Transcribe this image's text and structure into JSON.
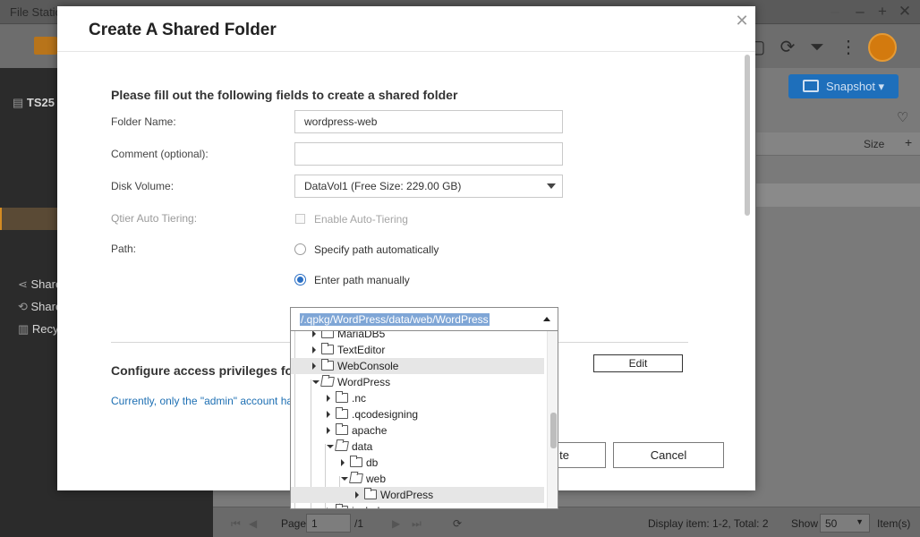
{
  "app": {
    "title": "File Station"
  },
  "toolbar": {
    "icons": [
      "calendar-icon",
      "refresh-icon",
      "filter-icon",
      "more-icon",
      "user-icon"
    ],
    "snapshot_label": "Snapshot"
  },
  "sidebar": {
    "items": [
      {
        "label": "TS25"
      },
      {
        "label": "Share"
      },
      {
        "label": "Share"
      },
      {
        "label": "Recy"
      }
    ]
  },
  "list": {
    "size_header": "Size",
    "add_column": "+"
  },
  "statusbar": {
    "page_label": "Page",
    "page_value": "1",
    "page_total": "/1",
    "display_info": "Display item: 1-2, Total: 2",
    "show_label": "Show",
    "show_value": "50",
    "items_label": "Item(s)"
  },
  "dialog": {
    "title": "Create A Shared Folder",
    "heading": "Please fill out the following fields to create a shared folder",
    "fields": {
      "folder_name_label": "Folder Name:",
      "folder_name_value": "wordpress-web",
      "comment_label": "Comment (optional):",
      "comment_value": "",
      "disk_volume_label": "Disk Volume:",
      "disk_volume_value": "DataVol1 (Free Size: 229.00 GB)",
      "qtier_label": "Qtier Auto Tiering:",
      "qtier_option": "Enable Auto-Tiering",
      "path_label": "Path:",
      "path_auto": "Specify path automatically",
      "path_manual": "Enter path manually"
    },
    "access_heading": "Configure access privileges for u",
    "access_info": "Currently, only the \"admin\" account ha",
    "edit_button": "Edit",
    "create_button": "te",
    "cancel_button": "Cancel"
  },
  "path_picker": {
    "value": "/.qpkg/WordPress/data/web/WordPress",
    "tree": [
      {
        "name": "MariaDB5",
        "level": 0,
        "expanded": false
      },
      {
        "name": "TextEditor",
        "level": 0,
        "expanded": false
      },
      {
        "name": "WebConsole",
        "level": 0,
        "expanded": false
      },
      {
        "name": "WordPress",
        "level": 0,
        "expanded": true
      },
      {
        "name": ".nc",
        "level": 1,
        "expanded": false
      },
      {
        "name": ".qcodesigning",
        "level": 1,
        "expanded": false
      },
      {
        "name": "apache",
        "level": 1,
        "expanded": false
      },
      {
        "name": "data",
        "level": 1,
        "expanded": true
      },
      {
        "name": "db",
        "level": 2,
        "expanded": false
      },
      {
        "name": "web",
        "level": 2,
        "expanded": true
      },
      {
        "name": "WordPress",
        "level": 3,
        "expanded": false
      },
      {
        "name": "includes",
        "level": 1,
        "expanded": false
      }
    ]
  }
}
